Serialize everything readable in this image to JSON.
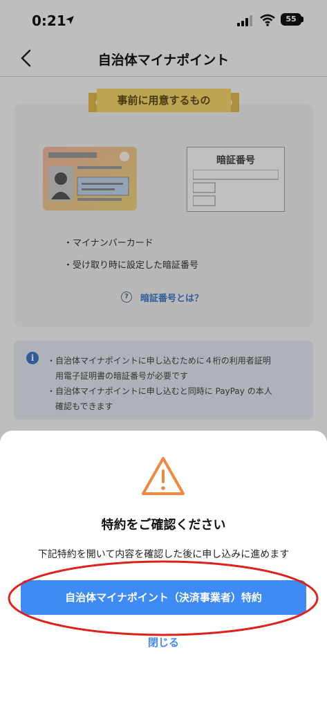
{
  "status": {
    "time": "0:21",
    "battery": "55"
  },
  "nav": {
    "title": "自治体マイナポイント"
  },
  "prep": {
    "ribbon": "事前に用意するもの",
    "pin_label": "暗証番号",
    "items": [
      "・マイナンバーカード",
      "・受け取り時に設定した暗証番号"
    ],
    "help_link": "暗証番号とは？"
  },
  "info": {
    "lines": [
      "・自治体マイナポイントに申し込むために４桁の利用者証明",
      "　用電子証明書の暗証番号が必要です",
      "・自治体マイナポイントに申し込むと同時に PayPay の本人",
      "　確認もできます"
    ]
  },
  "sheet": {
    "title": "特約をご確認ください",
    "description": "下記特約を開いて内容を確認した後に申し込みに進めます",
    "primary_button": "自治体マイナポイント（決済事業者）特約",
    "close": "閉じる"
  },
  "colors": {
    "accent": "#3e8bf5",
    "warning": "#f0883e",
    "annotation": "#e0201a"
  }
}
